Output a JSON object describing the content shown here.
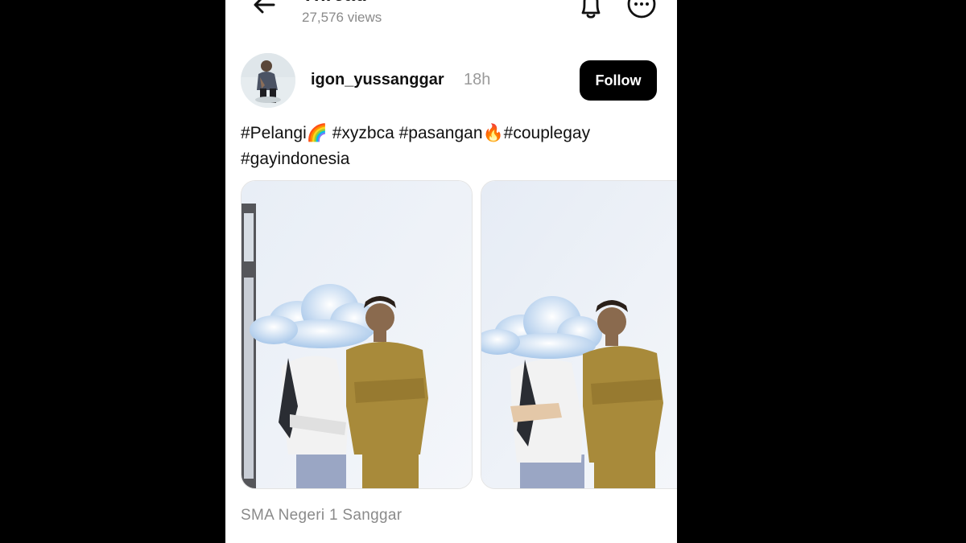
{
  "header": {
    "title": "Thread",
    "views": "27,576 views"
  },
  "post": {
    "username": "igon_yussanggar",
    "time": "18h",
    "follow_label": "Follow",
    "caption": {
      "line1": "#Pelangi🌈 #xyzbca #pasangan🔥#couplegay",
      "line2": "#gayindonesia"
    },
    "photos": [
      {
        "name": "photo-1"
      },
      {
        "name": "photo-2"
      }
    ],
    "location": "SMA Negeri 1 Sanggar"
  },
  "icons": {
    "back": "back-arrow-icon",
    "bell": "bell-icon",
    "more": "more-options-icon"
  },
  "colors": {
    "follow_bg": "#000000",
    "muted_text": "#8a8a8a",
    "uniform_khaki": "#a88a3a"
  }
}
